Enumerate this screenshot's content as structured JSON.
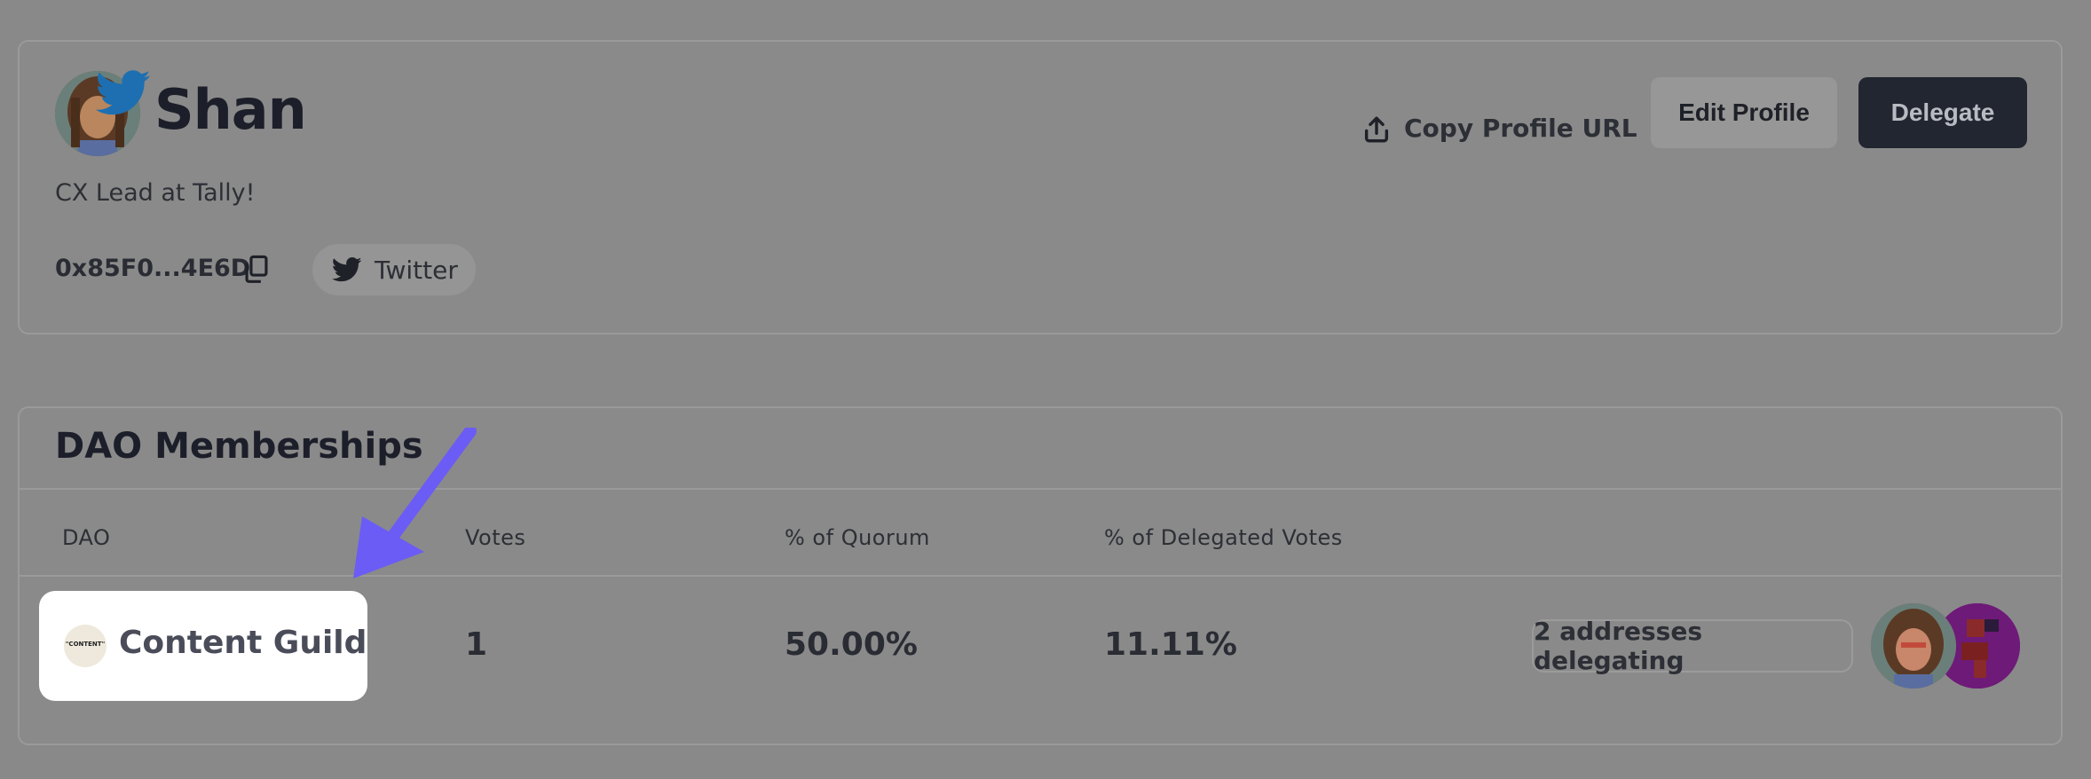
{
  "profile": {
    "name": "Shan",
    "bio": "CX Lead at Tally!",
    "address": "0x85F0...4E6D",
    "twitter_label": "Twitter",
    "actions": {
      "copy_url_label": "Copy Profile URL",
      "edit_label": "Edit Profile",
      "delegate_label": "Delegate"
    }
  },
  "dao_memberships": {
    "title": "DAO Memberships",
    "columns": [
      "DAO",
      "Votes",
      "% of Quorum",
      "% of Delegated Votes"
    ],
    "rows": [
      {
        "dao": "Content Guild",
        "dao_logo_text": "\"CONTENT\"",
        "votes": "1",
        "quorum": "50.00%",
        "delegated": "11.11%",
        "delegators_label": "2 addresses delegating"
      }
    ]
  },
  "icons": [
    "twitter-bird-icon",
    "copy-icon",
    "upload-icon",
    "annotation-arrow"
  ],
  "colors": {
    "overlay_bg": "#898989",
    "delegate_button": "#222631",
    "twitter_blue": "#1d6fb1",
    "arrow": "#6b5cf5",
    "highlight": "#ffffff"
  }
}
